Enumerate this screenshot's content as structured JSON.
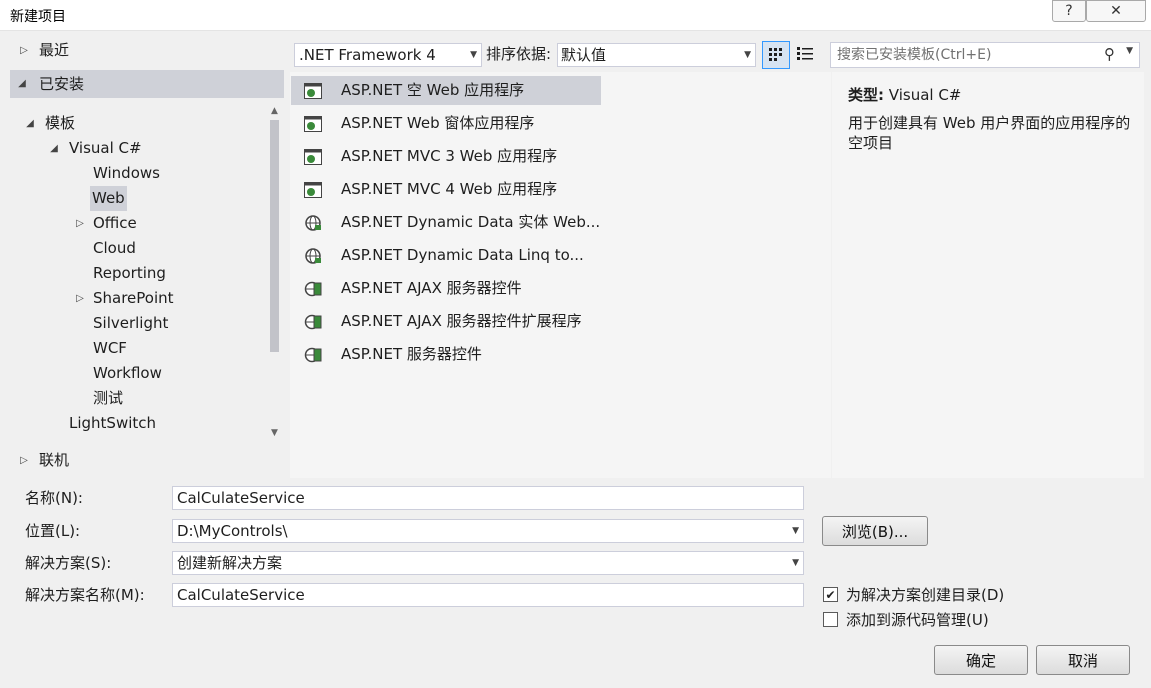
{
  "window": {
    "title": "新建项目",
    "help_glyph": "?",
    "close_glyph": "✕"
  },
  "tree": {
    "recent": "最近",
    "installed": "已安装",
    "templates": "模板",
    "visual_csharp": "Visual C#",
    "children": [
      "Windows",
      "Web",
      "Office",
      "Cloud",
      "Reporting",
      "SharePoint",
      "Silverlight",
      "WCF",
      "Workflow",
      "测试"
    ],
    "lightswitch": "LightSwitch",
    "online": "联机"
  },
  "toolbar": {
    "framework": ".NET Framework 4",
    "sort_label": "排序依据:",
    "sort_value": "默认值",
    "search_placeholder": "搜索已安装模板(Ctrl+E)"
  },
  "templates": [
    {
      "label": "ASP.NET 空 Web 应用程序",
      "icon": "web-app-icon"
    },
    {
      "label": "ASP.NET Web 窗体应用程序",
      "icon": "web-app-icon"
    },
    {
      "label": "ASP.NET MVC 3 Web 应用程序",
      "icon": "web-app-icon"
    },
    {
      "label": "ASP.NET MVC 4 Web 应用程序",
      "icon": "web-app-icon"
    },
    {
      "label": "ASP.NET Dynamic Data 实体 Web...",
      "icon": "globe-icon"
    },
    {
      "label": "ASP.NET Dynamic Data Linq to...",
      "icon": "globe-icon"
    },
    {
      "label": "ASP.NET AJAX 服务器控件",
      "icon": "server-control-icon"
    },
    {
      "label": "ASP.NET AJAX 服务器控件扩展程序",
      "icon": "server-control-icon"
    },
    {
      "label": "ASP.NET 服务器控件",
      "icon": "server-control-icon"
    }
  ],
  "description": {
    "type_label": "类型:",
    "type_value": "Visual C#",
    "text": "用于创建具有 Web 用户界面的应用程序的空项目"
  },
  "form": {
    "name_label": "名称(N):",
    "name_value": "CalCulateService",
    "location_label": "位置(L):",
    "location_value": "D:\\MyControls\\",
    "browse_label": "浏览(B)...",
    "solution_label": "解决方案(S):",
    "solution_value": "创建新解决方案",
    "solution_name_label": "解决方案名称(M):",
    "solution_name_value": "CalCulateService",
    "create_dir_label": "为解决方案创建目录(D)",
    "create_dir_checked": true,
    "source_control_label": "添加到源代码管理(U)",
    "source_control_checked": false,
    "ok_label": "确定",
    "cancel_label": "取消"
  },
  "colors": {
    "selection": "#cfd1d8",
    "icon_green": "#3a8a3a",
    "accent_blue": "#3399ff"
  }
}
